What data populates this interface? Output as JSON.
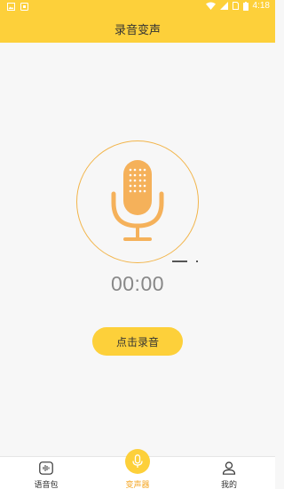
{
  "status_bar": {
    "time": "4:18"
  },
  "header": {
    "title": "录音变声"
  },
  "recorder": {
    "timer": "00:00",
    "record_button_label": "点击录音"
  },
  "bottom_nav": {
    "items": [
      {
        "label": "语音包",
        "icon": "voice-pack-icon",
        "active": false
      },
      {
        "label": "变声器",
        "icon": "microphone-icon",
        "active": true
      },
      {
        "label": "我的",
        "icon": "profile-icon",
        "active": false
      }
    ]
  },
  "colors": {
    "accent": "#fdd03a",
    "mic": "#f5b15a",
    "active_label": "#f5a623"
  }
}
